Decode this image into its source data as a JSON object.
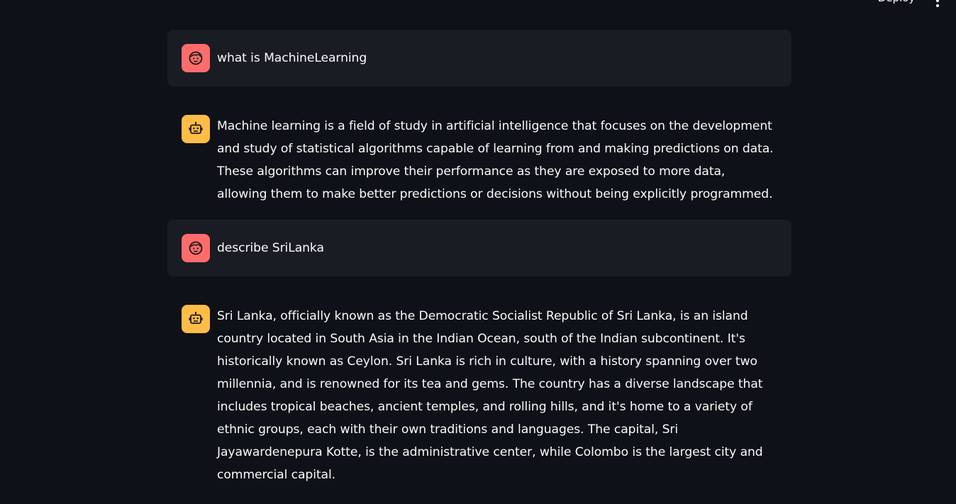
{
  "header": {
    "deploy_label": "Deploy",
    "menu_icon": "vertical-ellipsis-icon"
  },
  "colors": {
    "background": "#0e1117",
    "user_bubble": "#1a1c24",
    "user_avatar": "#ff6c6c",
    "assistant_avatar": "#ffbd45",
    "text": "#fafafa"
  },
  "messages": [
    {
      "role": "user",
      "avatar_icon": "user-face-icon",
      "text": "what is MachineLearning"
    },
    {
      "role": "assistant",
      "avatar_icon": "robot-icon",
      "text": "Machine learning is a field of study in artificial intelligence that focuses on the development and study of statistical algorithms capable of learning from and making predictions on data. These algorithms can improve their performance as they are exposed to more data, allowing them to make better predictions or decisions without being explicitly programmed."
    },
    {
      "role": "user",
      "avatar_icon": "user-face-icon",
      "text": "describe SriLanka"
    },
    {
      "role": "assistant",
      "avatar_icon": "robot-icon",
      "text": "Sri Lanka, officially known as the Democratic Socialist Republic of Sri Lanka, is an island country located in South Asia in the Indian Ocean, south of the Indian subcontinent. It's historically known as Ceylon. Sri Lanka is rich in culture, with a history spanning over two millennia, and is renowned for its tea and gems. The country has a diverse landscape that includes tropical beaches, ancient temples, and rolling hills, and it's home to a variety of ethnic groups, each with their own traditions and languages. The capital, Sri Jayawardenepura Kotte, is the administrative center, while Colombo is the largest city and commercial capital."
    }
  ]
}
